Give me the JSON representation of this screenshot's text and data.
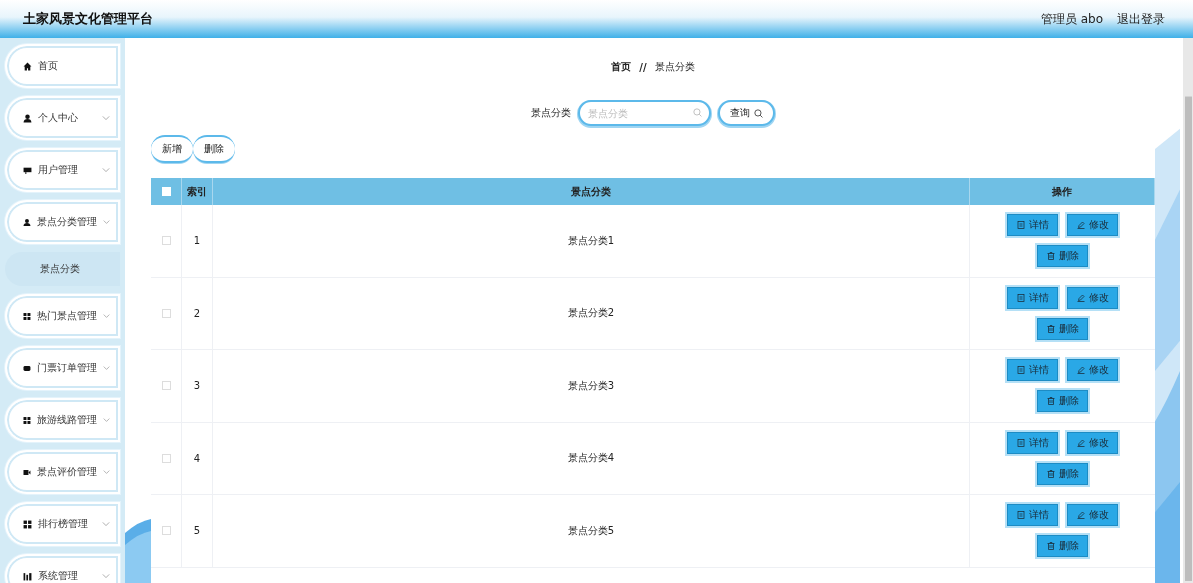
{
  "header": {
    "title": "土家风景文化管理平台",
    "user": "管理员 abo",
    "logout": "退出登录"
  },
  "sidebar": {
    "items": [
      {
        "label": "首页",
        "kind": "link"
      },
      {
        "label": "个人中心",
        "kind": "group"
      },
      {
        "label": "用户管理",
        "kind": "group"
      },
      {
        "label": "景点分类管理",
        "kind": "group",
        "children": [
          {
            "label": "景点分类",
            "selected": true
          }
        ]
      },
      {
        "label": "热门景点管理",
        "kind": "group"
      },
      {
        "label": "门票订单管理",
        "kind": "group"
      },
      {
        "label": "旅游线路管理",
        "kind": "group"
      },
      {
        "label": "景点评价管理",
        "kind": "group"
      },
      {
        "label": "排行榜管理",
        "kind": "group"
      },
      {
        "label": "系统管理",
        "kind": "group"
      }
    ]
  },
  "breadcrumb": {
    "home": "首页",
    "separator": "//",
    "current": "景点分类"
  },
  "search": {
    "label": "景点分类",
    "placeholder": "景点分类",
    "button": "查询"
  },
  "toolbar": {
    "buttons": [
      "新增",
      "删除"
    ]
  },
  "table": {
    "header_checked": false,
    "columns": [
      "索引",
      "景点分类",
      "操作"
    ],
    "rows": [
      {
        "checked": false,
        "index": "1",
        "name": "景点分类1",
        "actions": [
          "详情",
          "修改",
          "删除"
        ]
      },
      {
        "checked": false,
        "index": "2",
        "name": "景点分类2",
        "actions": [
          "详情",
          "修改",
          "删除"
        ]
      },
      {
        "checked": false,
        "index": "3",
        "name": "景点分类3",
        "actions": [
          "详情",
          "修改",
          "删除"
        ]
      },
      {
        "checked": false,
        "index": "4",
        "name": "景点分类4",
        "actions": [
          "详情",
          "修改",
          "删除"
        ]
      },
      {
        "checked": false,
        "index": "5",
        "name": "景点分类5",
        "actions": [
          "详情",
          "修改",
          "删除"
        ]
      }
    ]
  }
}
